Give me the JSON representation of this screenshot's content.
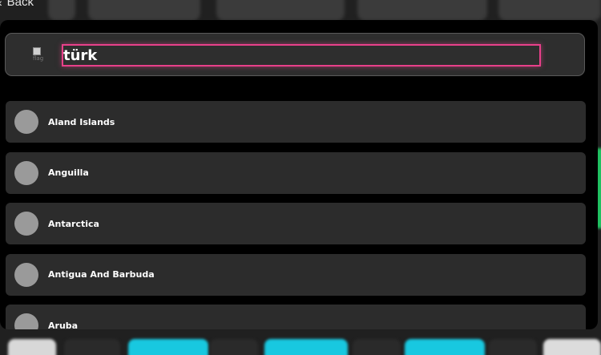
{
  "nav": {
    "back_label": "Back"
  },
  "search": {
    "value": "türk",
    "flag_alt": "flag"
  },
  "countries": [
    {
      "label": "Aland Islands"
    },
    {
      "label": "Anguilla"
    },
    {
      "label": "Antarctica"
    },
    {
      "label": "Antigua And Barbuda"
    },
    {
      "label": "Aruba"
    }
  ],
  "colors": {
    "focus_ring": "#e8408a",
    "item_bg": "#2c2c2c",
    "avatar": "#9a9a9a",
    "modal_bg": "#000000"
  }
}
